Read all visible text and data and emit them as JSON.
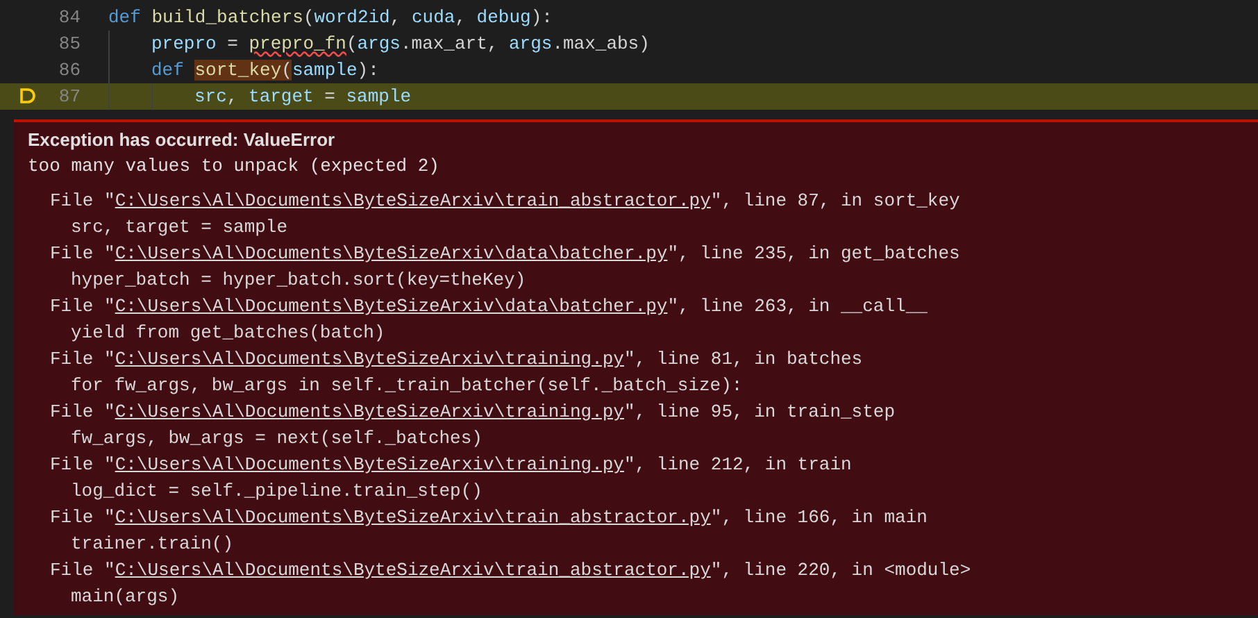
{
  "editor": {
    "lines": [
      {
        "number": "84",
        "current": false,
        "tokens": [
          {
            "text": "def ",
            "kind": "keyword"
          },
          {
            "text": "build_batchers",
            "kind": "function"
          },
          {
            "text": "(",
            "kind": "plain"
          },
          {
            "text": "word2id",
            "kind": "param"
          },
          {
            "text": ", ",
            "kind": "plain"
          },
          {
            "text": "cuda",
            "kind": "param"
          },
          {
            "text": ", ",
            "kind": "plain"
          },
          {
            "text": "debug",
            "kind": "param"
          },
          {
            "text": "):",
            "kind": "plain"
          }
        ],
        "children": [
          {
            "number": "85",
            "current": false,
            "tokens": [
              {
                "text": "prepro",
                "kind": "variable"
              },
              {
                "text": " = ",
                "kind": "plain"
              },
              {
                "text": "prepro_fn",
                "kind": "function",
                "squiggle": true
              },
              {
                "text": "(",
                "kind": "plain"
              },
              {
                "text": "args",
                "kind": "variable"
              },
              {
                "text": ".max_art, ",
                "kind": "plain"
              },
              {
                "text": "args",
                "kind": "variable"
              },
              {
                "text": ".max_abs)",
                "kind": "plain"
              }
            ]
          },
          {
            "number": "86",
            "current": false,
            "tokens": [
              {
                "text": "def ",
                "kind": "keyword"
              },
              {
                "text": "sort_key",
                "kind": "function",
                "highlighted": true
              },
              {
                "text": "(",
                "kind": "plain",
                "highlighted": true
              },
              {
                "text": "sample",
                "kind": "param"
              },
              {
                "text": "):",
                "kind": "plain"
              }
            ],
            "children": [
              {
                "number": "87",
                "current": true,
                "tokens": [
                  {
                    "text": "src",
                    "kind": "variable"
                  },
                  {
                    "text": ", ",
                    "kind": "plain"
                  },
                  {
                    "text": "target",
                    "kind": "variable"
                  },
                  {
                    "text": " = ",
                    "kind": "plain"
                  },
                  {
                    "text": "sample",
                    "kind": "variable"
                  }
                ]
              }
            ]
          }
        ]
      }
    ]
  },
  "exception": {
    "title": "Exception has occurred: ValueError",
    "message": "too many values to unpack (expected 2)",
    "frames": [
      {
        "prefix": "File \"",
        "path": "C:\\Users\\Al\\Documents\\ByteSizeArxiv\\train_abstractor.py",
        "suffix": "\", line 87, in sort_key",
        "code": "src, target = sample",
        "linked": true
      },
      {
        "prefix": "File \"",
        "path": "C:\\Users\\Al\\Documents\\ByteSizeArxiv\\data\\batcher.py",
        "suffix": "\", line 235, in get_batches",
        "code": "hyper_batch = hyper_batch.sort(key=theKey)",
        "linked": true
      },
      {
        "prefix": "File \"",
        "path": "C:\\Users\\Al\\Documents\\ByteSizeArxiv\\data\\batcher.py",
        "suffix": "\", line 263, in __call__",
        "code": "yield from get_batches(batch)",
        "linked": true
      },
      {
        "prefix": "File \"",
        "path": "C:\\Users\\Al\\Documents\\ByteSizeArxiv\\training.py",
        "suffix": "\", line 81, in batches",
        "code": "for fw_args, bw_args in self._train_batcher(self._batch_size):",
        "linked": true
      },
      {
        "prefix": "File \"",
        "path": "C:\\Users\\Al\\Documents\\ByteSizeArxiv\\training.py",
        "suffix": "\", line 95, in train_step",
        "code": "fw_args, bw_args = next(self._batches)",
        "linked": true
      },
      {
        "prefix": "File \"",
        "path": "C:\\Users\\Al\\Documents\\ByteSizeArxiv\\training.py",
        "suffix": "\", line 212, in train",
        "code": "log_dict = self._pipeline.train_step()",
        "linked": true
      },
      {
        "prefix": "File \"",
        "path": "C:\\Users\\Al\\Documents\\ByteSizeArxiv\\train_abstractor.py",
        "suffix": "\", line 166, in main",
        "code": "trainer.train()",
        "linked": true
      },
      {
        "prefix": "File \"",
        "path": "C:\\Users\\Al\\Documents\\ByteSizeArxiv\\train_abstractor.py",
        "suffix": "\", line 220, in <module>",
        "code": "main(args)",
        "linked": true
      }
    ]
  }
}
